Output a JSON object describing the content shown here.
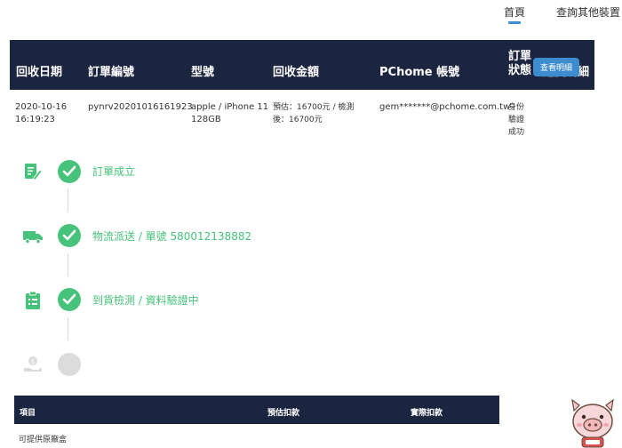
{
  "nav": {
    "home": "首頁",
    "query_other": "查詢其他裝置"
  },
  "order_table": {
    "headers": {
      "date": "回收日期",
      "order_no": "訂單編號",
      "model": "型號",
      "amount": "回收金額",
      "account": "PChome 帳號",
      "status": "訂單狀態",
      "detail": "進度明細"
    },
    "row": {
      "date": "2020-10-16",
      "time": "16:19:23",
      "order_no": "pynrv20201016161923",
      "model_line1": "apple / iPhone 11",
      "model_line2": "128GB",
      "amount_line1": "預估：16700元 / 檢測",
      "amount_line2": "後：16700元",
      "account": "gem*******@pchome.com.tw",
      "status_line1": "身份",
      "status_line2": "驗證",
      "status_line3": "成功",
      "detail_button": "查看明細"
    }
  },
  "timeline": {
    "steps": [
      {
        "label": "訂單成立",
        "icon": "document-edit-icon",
        "done": true
      },
      {
        "label": "物流派送 / 單號 580012138882",
        "icon": "delivery-truck-icon",
        "done": true
      },
      {
        "label": "到貨檢測 / 資料驗證中",
        "icon": "clipboard-check-icon",
        "done": true
      },
      {
        "label": "",
        "icon": "hand-money-icon",
        "done": false
      }
    ],
    "done_color": "#46c27a",
    "pending_color": "#dcdcdc"
  },
  "deduction_table": {
    "headers": {
      "item": "項目",
      "estimate": "預估扣款",
      "actual": "實際扣款"
    },
    "rows": [
      {
        "item": "可提供原廠盒"
      }
    ]
  },
  "colors": {
    "header_bg": "#1c2540",
    "accent": "#3d8ccd",
    "success": "#46c27a"
  }
}
